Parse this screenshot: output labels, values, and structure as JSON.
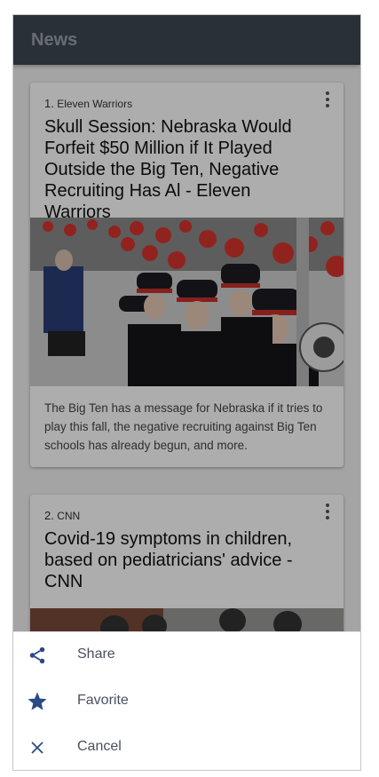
{
  "app": {
    "title": "News"
  },
  "articles": [
    {
      "number": "1.",
      "source": "Eleven Warriors",
      "title": "Skull Session: Nebraska Would Forfeit $50 Million if It Played Outside the Big Ten, Negative Recruiting Has Al - Eleven Warriors",
      "description": "The Big Ten has a message for Nebraska if it tries to play this fall, the negative recruiting against Big Ten schools has already begun, and more.",
      "image_label": "Skull Session",
      "more_icon": "more-vert-icon"
    },
    {
      "number": "2.",
      "source": "CNN",
      "title": "Covid-19 symptoms in children, based on pediatricians' advice - CNN",
      "more_icon": "more-vert-icon"
    }
  ],
  "action_sheet": {
    "items": [
      {
        "label": "Share",
        "icon": "share-icon"
      },
      {
        "label": "Favorite",
        "icon": "star-icon"
      },
      {
        "label": "Cancel",
        "icon": "close-icon"
      }
    ]
  },
  "colors": {
    "appbar": "#3f4851",
    "scrim": "rgba(0,0,0,0.32)",
    "icon_accent": "#2a4a85",
    "sheet_text": "#4a5060"
  }
}
